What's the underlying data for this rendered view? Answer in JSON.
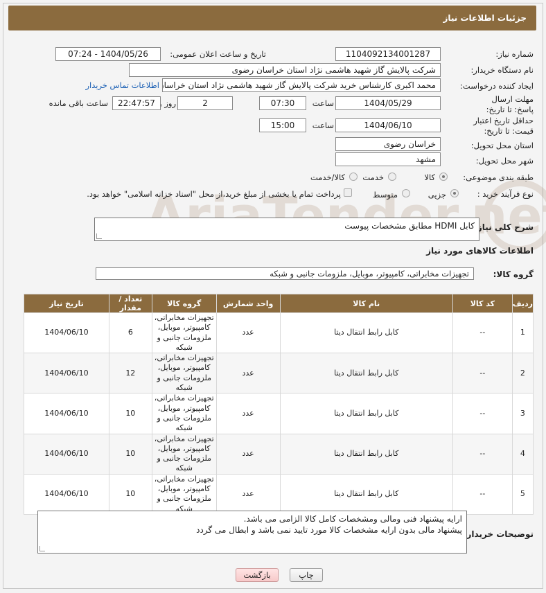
{
  "header": {
    "title": "جزئیات اطلاعات نیاز"
  },
  "form": {
    "need_number_label": "شماره نیاز:",
    "need_number": "1104092134001287",
    "announce_label": "تاریخ و ساعت اعلان عمومی:",
    "announce_value": "1404/05/26 - 07:24",
    "buyer_org_label": "نام دستگاه خریدار:",
    "buyer_org": "شرکت پالایش گاز شهید هاشمی نژاد   استان خراسان رضوی",
    "creator_label": "ایجاد کننده درخواست:",
    "creator": "محمد اکبری کارشناس خرید شرکت پالایش گاز شهید هاشمی نژاد   استان خراسان رضوی",
    "contact_link": "اطلاعات تماس خریدار",
    "reply_deadline_label": "مهلت ارسال پاسخ: تا تاریخ:",
    "reply_date": "1404/05/29",
    "time_label": "ساعت",
    "reply_time": "07:30",
    "days_value": "2",
    "days_label": "روز و",
    "remaining_time": "22:47:57",
    "remaining_label": "ساعت باقی مانده",
    "price_validity_label": "حداقل تاریخ اعتبار قیمت: تا تاریخ:",
    "price_date": "1404/06/10",
    "price_time": "15:00",
    "province_label": "استان محل تحویل:",
    "province": "خراسان رضوی",
    "city_label": "شهر محل تحویل:",
    "city": "مشهد",
    "category_label": "طبقه بندی موضوعی:",
    "category_options": [
      "کالا",
      "خدمت",
      "کالا/خدمت"
    ],
    "category_selected": "کالا",
    "process_label": "نوع فرآیند خرید :",
    "process_options": [
      "جزیی",
      "متوسط"
    ],
    "process_selected": "جزیی",
    "payment_note": "پرداخت تمام یا بخشی از مبلغ خرید،از محل \"اسناد خزانه اسلامی\" خواهد بود."
  },
  "description": {
    "label": "شرح کلی نیاز:",
    "text": "کابل HDMI مطابق مشخصات پیوست"
  },
  "goods": {
    "section_title": "اطلاعات کالاهای مورد نیاز",
    "group_label": "گروه کالا:",
    "group_value": "تجهیزات مخابراتی، کامپیوتر، موبایل، ملزومات جانبی و شبکه"
  },
  "table": {
    "headers": [
      "ردیف",
      "کد کالا",
      "نام کالا",
      "واحد شمارش",
      "گروه کالا",
      "تعداد / مقدار",
      "تاریخ نیاز"
    ],
    "rows": [
      [
        "1",
        "--",
        "کابل رابط انتقال دیتا",
        "عدد",
        "تجهیزات مخابراتی، کامپیوتر، موبایل، ملزومات جانبی و شبکه",
        "6",
        "1404/06/10"
      ],
      [
        "2",
        "--",
        "کابل رابط انتقال دیتا",
        "عدد",
        "تجهیزات مخابراتی، کامپیوتر، موبایل، ملزومات جانبی و شبکه",
        "12",
        "1404/06/10"
      ],
      [
        "3",
        "--",
        "کابل رابط انتقال دیتا",
        "عدد",
        "تجهیزات مخابراتی، کامپیوتر، موبایل، ملزومات جانبی و شبکه",
        "10",
        "1404/06/10"
      ],
      [
        "4",
        "--",
        "کابل رابط انتقال دیتا",
        "عدد",
        "تجهیزات مخابراتی، کامپیوتر، موبایل، ملزومات جانبی و شبکه",
        "10",
        "1404/06/10"
      ],
      [
        "5",
        "--",
        "کابل رابط انتقال دیتا",
        "عدد",
        "تجهیزات مخابراتی، کامپیوتر، موبایل، ملزومات جانبی و شبکه",
        "10",
        "1404/06/10"
      ]
    ]
  },
  "buyer_notes": {
    "label": "توضیحات خریدار:",
    "line1": "ارایه پیشنهاد فنی ومالی ومشخصات کامل کالا الزامی می باشد.",
    "line2": "پیشنهاد مالی بدون ارایه مشخصات کالا مورد تایید نمی باشد و ابطال می گردد"
  },
  "buttons": {
    "print": "چاپ",
    "back": "بازگشت"
  },
  "watermark": "AriaTender.net"
}
